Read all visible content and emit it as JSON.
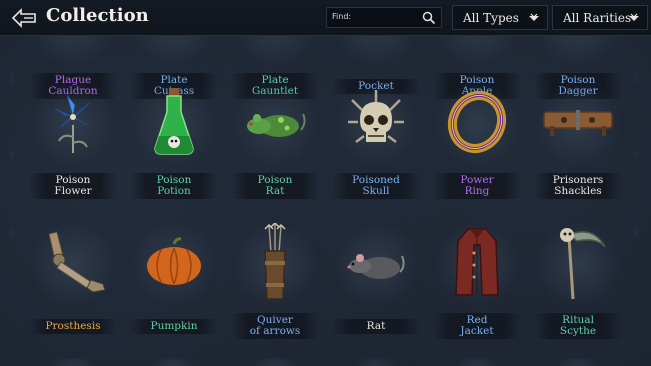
{
  "header": {
    "title": "Collection",
    "search": {
      "label": "Find:",
      "value": "",
      "placeholder": ""
    },
    "type_filter": "All Types",
    "rarity_filter": "All Rarities"
  },
  "colors": {
    "common": "#e9e6dc",
    "uncommon": "#5fd0a8",
    "rare": "#7bb0f0",
    "epic": "#b56cf0",
    "legendary": "#f0a840"
  },
  "rows": [
    {
      "items": [
        {
          "name": "Plague\nCauldron",
          "rarity": "epic"
        },
        {
          "name": "Plate\nCuirass",
          "rarity": "rare"
        },
        {
          "name": "Plate\nGauntlet",
          "rarity": "uncommon"
        },
        {
          "name": "Pocket",
          "rarity": "rare"
        },
        {
          "name": "Poison\nApple",
          "rarity": "rare"
        },
        {
          "name": "Poison\nDagger",
          "rarity": "rare"
        }
      ]
    },
    {
      "items": [
        {
          "name": "Poison\nFlower",
          "rarity": "common",
          "icon": "blue-flower-icon"
        },
        {
          "name": "Poison\nPotion",
          "rarity": "uncommon",
          "icon": "green-potion-icon"
        },
        {
          "name": "Poison\nRat",
          "rarity": "uncommon",
          "icon": "green-rat-icon"
        },
        {
          "name": "Poisoned\nSkull",
          "rarity": "rare",
          "icon": "spiked-skull-icon"
        },
        {
          "name": "Power\nRing",
          "rarity": "epic",
          "icon": "gold-ring-icon"
        },
        {
          "name": "Prisoners\nShackles",
          "rarity": "common",
          "icon": "wooden-shackles-icon"
        }
      ]
    },
    {
      "items": [
        {
          "name": "Prosthesis",
          "rarity": "legendary",
          "icon": "metal-arm-icon"
        },
        {
          "name": "Pumpkin",
          "rarity": "uncommon",
          "icon": "pumpkin-icon"
        },
        {
          "name": "Quiver\nof arrows",
          "rarity": "rare",
          "icon": "quiver-icon"
        },
        {
          "name": "Rat",
          "rarity": "common",
          "icon": "grey-rat-icon"
        },
        {
          "name": "Red\nJacket",
          "rarity": "rare",
          "icon": "red-jacket-icon"
        },
        {
          "name": "Ritual\nScythe",
          "rarity": "uncommon",
          "icon": "bone-scythe-icon"
        }
      ]
    }
  ]
}
